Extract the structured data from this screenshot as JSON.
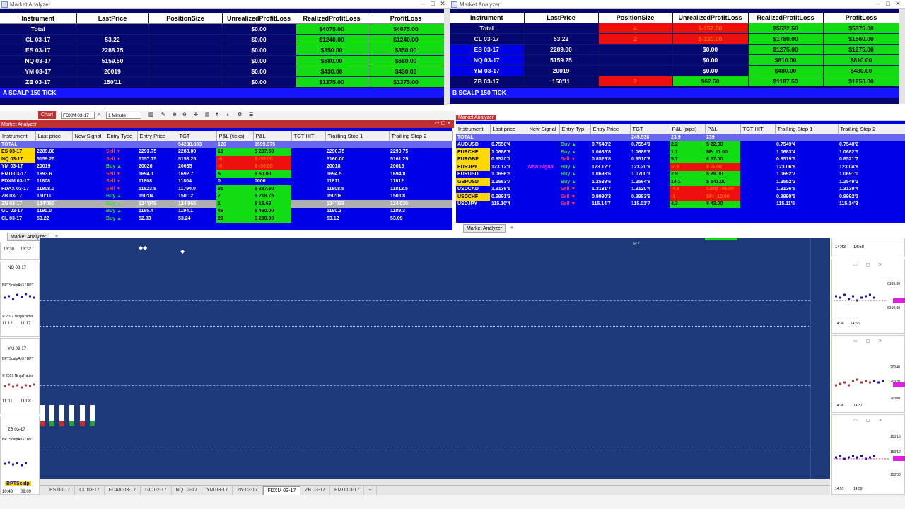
{
  "top_left": {
    "window_title": "Market Analyzer",
    "headers": [
      "Instrument",
      "LastPrice",
      "PositionSize",
      "UnrealizedProfitLoss",
      "RealizedProfitLoss",
      "ProfitLoss"
    ],
    "rows": [
      [
        "Total",
        "",
        "",
        "$0.00",
        "$4075.00",
        "$4075.00"
      ],
      [
        "CL 03-17",
        "53.22",
        "",
        "$0.00",
        "$1240.00",
        "$1240.00"
      ],
      [
        "ES 03-17",
        "2288.75",
        "",
        "$0.00",
        "$350.00",
        "$350.00"
      ],
      [
        "NQ 03-17",
        "5159.50",
        "",
        "$0.00",
        "$680.00",
        "$680.00"
      ],
      [
        "YM 03-17",
        "20019",
        "",
        "$0.00",
        "$430.00",
        "$430.00"
      ],
      [
        "ZB 03-17",
        "150'11",
        "",
        "$0.00",
        "$1375.00",
        "$1375.00"
      ]
    ],
    "caption": "A SCALP 150 TICK"
  },
  "top_right": {
    "window_title": "Market Analyzer",
    "headers": [
      "Instrument",
      "LastPrice",
      "PositionSize",
      "UnrealizedProfitLoss",
      "RealizedProfitLoss",
      "ProfitLoss"
    ],
    "rows": [
      [
        "Total",
        "",
        "4",
        "$-157.50",
        "$5532.50",
        "$5375.00"
      ],
      [
        "CL 03-17",
        "53.22",
        "2",
        "$-220.00",
        "$1780.00",
        "$1560.00"
      ],
      [
        "ES 03-17",
        "2289.00",
        "",
        "$0.00",
        "$1275.00",
        "$1275.00"
      ],
      [
        "NQ 03-17",
        "5159.25",
        "",
        "$0.00",
        "$810.00",
        "$810.00"
      ],
      [
        "YM 03-17",
        "20019",
        "",
        "$0.00",
        "$480.00",
        "$480.00"
      ],
      [
        "ZB 03-17",
        "150'11",
        "2",
        "$62.50",
        "$1187.50",
        "$1250.00"
      ]
    ],
    "caption": "B SCALP 150 TICK"
  },
  "chart_window": {
    "tab_label": "Chart",
    "instrument": "FDXM 03-17",
    "interval": "1 Minute",
    "price_label": "R7"
  },
  "mid_left": {
    "window_title": "Market Analyzer",
    "headers": [
      "Instrument",
      "Last price",
      "New Signal",
      "Entry Type",
      "Entry Price",
      "TGT",
      "P&L (ticks)",
      "P&L",
      "TGT HIT",
      "Trailling Stop 1",
      "Trailling Stop 2"
    ],
    "rows": [
      [
        "TOTAL",
        "",
        "",
        "",
        "",
        "54288.883",
        "126",
        "1599.375",
        "",
        "",
        ""
      ],
      [
        "ES 03-17",
        "2289.00",
        "",
        "Sell ▼",
        "2293.75",
        "2288.00",
        "19",
        "$ 237.50",
        "",
        "2290.75",
        "2290.75"
      ],
      [
        "NQ 03-17",
        "5159.25",
        "",
        "Sell ▼",
        "5157.75",
        "5153.25",
        "-6",
        "$ -30.00",
        "",
        "5160.00",
        "5161.25"
      ],
      [
        "YM 03-17",
        "20019",
        "",
        "Buy ▲",
        "20026",
        "20035",
        "-6",
        "$ -30.00",
        "",
        "20018",
        "20015"
      ],
      [
        "EMD 03-17",
        "1693.6",
        "",
        "Sell ▼",
        "1694.1",
        "1692.7",
        "5",
        "$ 50.00",
        "",
        "1694.5",
        "1694.8"
      ],
      [
        "FDXM 03-17",
        "11808",
        "",
        "Sell ▼",
        "11808",
        "11804",
        "0",
        "0000",
        "",
        "11811",
        "11812"
      ],
      [
        "FDAX 03-17",
        "11808.0",
        "",
        "Sell ▼",
        "11823.5",
        "11794.0",
        "31",
        "$ 387.50",
        "",
        "11808.5",
        "11812.5"
      ],
      [
        "ZB 03-17",
        "150'11",
        "",
        "Buy ▲",
        "150'04",
        "150'12",
        "7",
        "$ 218.75",
        "",
        "150'09",
        "150'08"
      ],
      [
        "ZN 03-17",
        "124'050",
        "",
        "Buy ▲",
        "124'045",
        "124'060",
        "1",
        "$ 15.63",
        "",
        "124'035",
        "124'030"
      ],
      [
        "GC 02-17",
        "1190.0",
        "",
        "Buy ▲",
        "1185.4",
        "1194.1",
        "46",
        "$ 460.00",
        "",
        "1190.2",
        "1189.3"
      ],
      [
        "CL 03-17",
        "53.22",
        "",
        "Buy ▲",
        "52.93",
        "53.24",
        "29",
        "$ 290.00",
        "",
        "53.12",
        "53.09"
      ]
    ],
    "tab_label": "Market Analyzer"
  },
  "mid_right": {
    "window_title": "Market Analyzer",
    "headers": [
      "Instrument",
      "Last price",
      "New Signal",
      "Entry Typ",
      "Entry Price",
      "TGT",
      "P&L (pips)",
      "P&L",
      "TGT HIT",
      "Trailling Stop 1",
      "Trailling Stop 2"
    ],
    "rows": [
      [
        "TOTAL",
        "",
        "",
        "",
        "",
        "245.538",
        "23.9",
        "239",
        "",
        "",
        ""
      ],
      [
        "AUDUSD",
        "0.7550'4",
        "",
        "Buy ▲",
        "0.7548'2",
        "0.7554'1",
        "2.2",
        "$ 22.00",
        "",
        "0.7549'4",
        "0.7548'2"
      ],
      [
        "EURCHF",
        "1.0686'9",
        "",
        "Buy ▲",
        "1.0685'8",
        "1.0689'6",
        "1.1",
        "$Fr 11.00",
        "",
        "1.0683'4",
        "1.0682'5"
      ],
      [
        "EURGBP",
        "0.8520'1",
        "",
        "Sell ▼",
        "0.8525'8",
        "0.8510'6",
        "5.7",
        "£ 57.00",
        "",
        "0.8519'5",
        "0.8521'7"
      ],
      [
        "EURJPY",
        "123.12'1",
        "New Signal",
        "Buy ▲",
        "123.12'7",
        "123.20'9",
        "-0.6",
        "¥ -6.00",
        "",
        "123.06'6",
        "123.04'8"
      ],
      [
        "EURUSD",
        "1.0696'5",
        "",
        "Buy ▲",
        "1.0693'6",
        "1.0700'1",
        "2.9",
        "$ 29.00",
        "",
        "1.0692'7",
        "1.0691'0"
      ],
      [
        "GBPUSD",
        "1.2563'7",
        "",
        "Buy ▲",
        "1.2539'6",
        "1.2564'9",
        "14.1",
        "$ 141.00",
        "",
        "1.2552'2",
        "1.2549'2"
      ],
      [
        "USDCAD",
        "1.3136'5",
        "",
        "Sell ▼",
        "1.3131'7",
        "1.3120'4",
        "-4.8",
        "Can$ -48.00",
        "",
        "1.3136'5",
        "1.3139'4"
      ],
      [
        "USDCHF",
        "0.9991'3",
        "",
        "Sell ▼",
        "0.9990'3",
        "0.9983'9",
        "-1",
        "$Fr -10.00",
        "",
        "0.9990'5",
        "0.9992'1"
      ],
      [
        "USDJPY",
        "115.10'4",
        "",
        "Sell ▼",
        "115.14'7",
        "115.01'7",
        "4.3",
        "¥ 43.00",
        "",
        "115.11'5",
        "115.14'3"
      ]
    ],
    "tab_label": "Market Analyzer"
  },
  "left_minis": [
    {
      "label": "NQ 03-17",
      "indicator": "BPTScalpAv3 / BPT",
      "copyright": "© 2017 NinjaTrader"
    },
    {
      "label": "YM 03-17",
      "indicator": "BPTScalpAv3 / BPT",
      "copyright": "© 2017 NinjaTrader"
    },
    {
      "label": "ZB 03-17",
      "indicator": "BPTScalpAv3 / BPT",
      "copyright": "BPTScalp"
    }
  ],
  "left_times": [
    "13:30",
    "13:32",
    "11:12",
    "11:17",
    "11:01",
    "11:08",
    "10:43",
    "09:09"
  ],
  "right_minis": [
    {
      "labels": [
        "6165.00",
        "6160.00"
      ],
      "times": [
        "14:36",
        "14:50"
      ]
    },
    {
      "labels": [
        "20040",
        "20020",
        "20000"
      ],
      "times": [
        "14:36",
        "14:37"
      ]
    },
    {
      "labels": [
        "150'16",
        "150'12",
        "150'08"
      ],
      "times": [
        "14:51",
        "14:59"
      ]
    }
  ],
  "right_top_times": [
    "14:43",
    "14:58"
  ],
  "bottom_tabs": [
    "ES 03-17",
    "CL 03-17",
    "FDAX 03-17",
    "GC 02-17",
    "NQ 03-17",
    "YM 03-17",
    "ZN 03-17",
    "FDXM 03-17",
    "ZB 03-17",
    "EMD 03-17",
    "+"
  ],
  "active_tab": "FDXM 03-17",
  "colors": {
    "navy": "#06066f",
    "green": "#12dc12",
    "red": "#ee0f0f",
    "blue": "#0000e8",
    "chart": "#1e3a7b"
  }
}
